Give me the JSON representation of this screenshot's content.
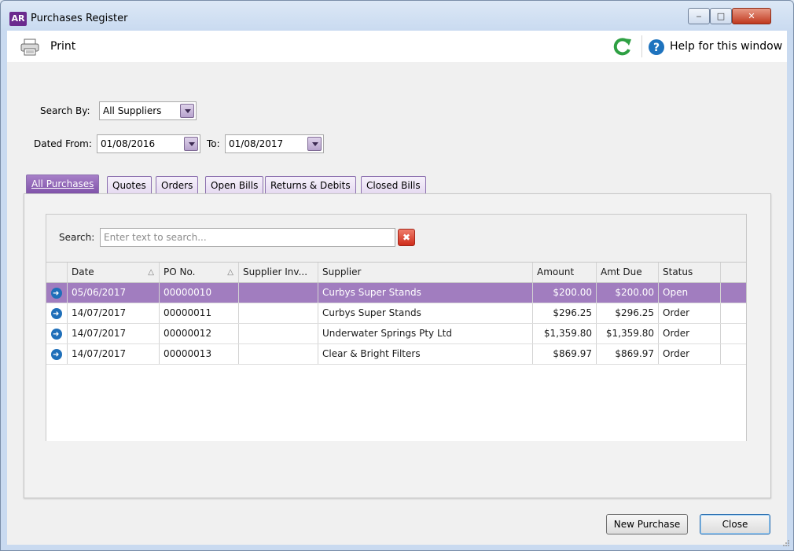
{
  "window": {
    "app_badge": "AR",
    "title": "Purchases Register"
  },
  "toolbar": {
    "print_label": "Print",
    "help_label": "Help for this window"
  },
  "filters": {
    "search_by_label": "Search By:",
    "search_by_value": "All Suppliers",
    "dated_from_label": "Dated From:",
    "dated_from_value": "01/08/2016",
    "to_label": "To:",
    "to_value": "01/08/2017"
  },
  "tabs": [
    {
      "label": "All Purchases",
      "active": true
    },
    {
      "label": "Quotes"
    },
    {
      "label": "Orders"
    },
    {
      "label": "Open Bills"
    },
    {
      "label": "Returns & Debits"
    },
    {
      "label": "Closed Bills"
    }
  ],
  "search": {
    "label": "Search:",
    "placeholder": "Enter text to search...",
    "value": ""
  },
  "table": {
    "columns": [
      "Date",
      "PO No.",
      "Supplier Inv...",
      "Supplier",
      "Amount",
      "Amt Due",
      "Status"
    ],
    "rows": [
      {
        "date": "05/06/2017",
        "po": "00000010",
        "supplier_inv": "",
        "supplier": "Curbys Super Stands",
        "amount": "$200.00",
        "amt_due": "$200.00",
        "status": "Open"
      },
      {
        "date": "14/07/2017",
        "po": "00000011",
        "supplier_inv": "",
        "supplier": "Curbys Super Stands",
        "amount": "$296.25",
        "amt_due": "$296.25",
        "status": "Order"
      },
      {
        "date": "14/07/2017",
        "po": "00000012",
        "supplier_inv": "",
        "supplier": "Underwater Springs Pty Ltd",
        "amount": "$1,359.80",
        "amt_due": "$1,359.80",
        "status": "Order"
      },
      {
        "date": "14/07/2017",
        "po": "00000013",
        "supplier_inv": "",
        "supplier": "Clear & Bright Filters",
        "amount": "$869.97",
        "amt_due": "$869.97",
        "status": "Order"
      }
    ]
  },
  "buttons": {
    "new_purchase": "New Purchase",
    "close": "Close"
  },
  "colors": {
    "accent": "#a17dbf",
    "tab_active": "#7d4fa7",
    "arrow": "#1f6fb9",
    "refresh": "#2ea043"
  }
}
